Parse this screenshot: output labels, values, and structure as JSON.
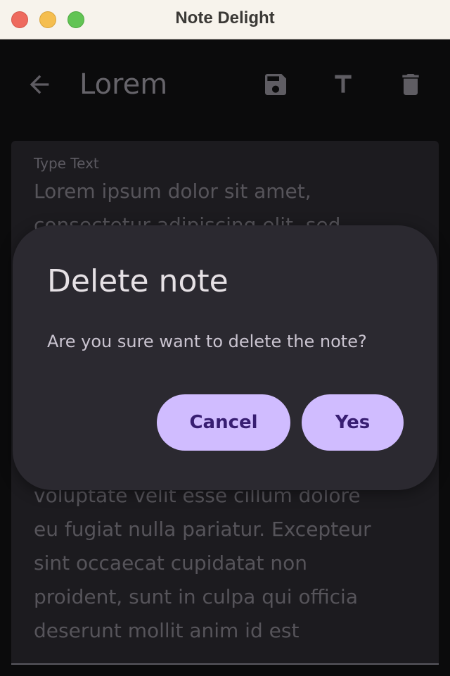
{
  "window": {
    "title": "Note Delight"
  },
  "appbar": {
    "note_title": "Lorem",
    "icons": [
      "arrow-back-icon",
      "save-icon",
      "text-format-icon",
      "delete-icon"
    ]
  },
  "note": {
    "field_label": "Type Text",
    "lines": [
      "Lorem ipsum dolor sit amet,",
      "consectetur adipiscing elit, sed",
      "",
      "",
      "",
      "",
      "",
      "",
      "",
      "voluptate velit esse cillum dolore",
      "eu fugiat nulla pariatur. Excepteur",
      "sint occaecat cupidatat non",
      "proident, sunt in culpa qui officia",
      "deserunt mollit anim id est"
    ]
  },
  "dialog": {
    "title": "Delete note",
    "message": "Are you sure want to delete the note?",
    "cancel_label": "Cancel",
    "confirm_label": "Yes"
  },
  "colors": {
    "titlebar": "#f7f3ec",
    "background": "#0b0b0c",
    "card": "#1c1b1f",
    "dialog": "#2b2930",
    "button": "#d0bcff",
    "button_text": "#381e72"
  }
}
